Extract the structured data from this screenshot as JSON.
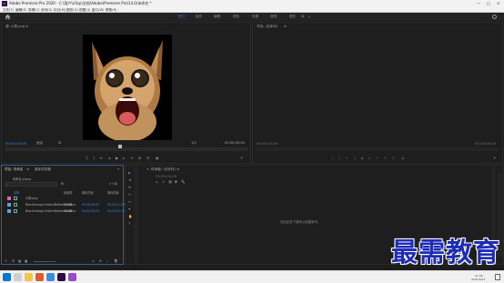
{
  "titlebar": {
    "app_icon": "Pr",
    "title": "Adobe Premiere Pro 2020 - C:\\用户\\Ulisp\\文档\\Adobe\\Premiere Pro\\14.0\\未命名 *",
    "minimize": "—",
    "maximize": "□",
    "close": "✕"
  },
  "menu": [
    "文件(F)",
    "编辑(E)",
    "剪辑(C)",
    "序列(S)",
    "标记(M)",
    "图形(G)",
    "视图(V)",
    "窗口(W)",
    "帮助(H)"
  ],
  "workspaces": [
    "学习",
    "组件",
    "编辑",
    "颜色",
    "效果",
    "音频",
    "图形",
    "库"
  ],
  "workspace_more": "»",
  "source": {
    "tab": "源: 小狗.png",
    "menu_icon": "≡",
    "timecode_in": "00;00;00;00",
    "fit": "适合",
    "page": "1/2",
    "timecode_out": "00;00;05;00"
  },
  "program": {
    "tab": "节目: (无序列)",
    "menu_icon": "≡",
    "timecode_in": "00;00;00;00",
    "timecode_out": "00;00;00;00"
  },
  "project": {
    "tab_active": "项目: 未命名",
    "tab_menu": "≡",
    "tab_2": "媒体浏览器",
    "tab_more": "»",
    "file": "未命名.prproj",
    "item_count": "3 个项",
    "columns": [
      "名称",
      "帧速率",
      "媒体开始",
      "媒体结束"
    ],
    "rows": [
      {
        "swatch": "#e060c0",
        "name": "小狗.png",
        "fps": "",
        "start": "",
        "end": ""
      },
      {
        "swatch": "#5aa0e0",
        "name": "BlackOrange SwitchBottom Anima",
        "fps": "30.00",
        "start": "00;00;00;00",
        "end": "00;00;01;04"
      },
      {
        "swatch": "#5aa0e0",
        "name": "BlackOrange SwitchBottom Anima",
        "fps": "30.00",
        "start": "00;00;00;00",
        "end": "00;00;01;17"
      }
    ]
  },
  "timeline": {
    "tab": "时间轴: (无序列)",
    "menu_icon": "≡",
    "timecode": "00;00;00;00",
    "empty_hint": "在此处放下媒体以创建序列。"
  },
  "taskbar": {
    "time": "11:56",
    "date": "2021/6/17"
  },
  "watermark": "最需教育",
  "colors": {
    "accent": "#2d8ceb",
    "panel_bg": "#1e1e1e",
    "watermark": "#1c2bb8"
  }
}
